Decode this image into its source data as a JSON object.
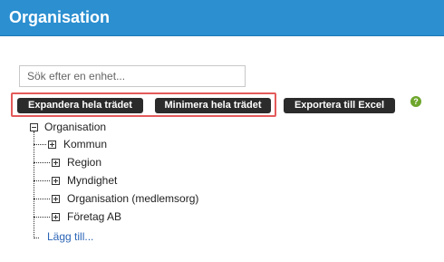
{
  "header": {
    "title": "Organisation"
  },
  "search": {
    "placeholder": "Sök efter en enhet..."
  },
  "toolbar": {
    "expand_label": "Expandera hela trädet",
    "collapse_label": "Minimera hela trädet",
    "export_label": "Exportera till Excel",
    "help_icon": "?"
  },
  "tree": {
    "root": "Organisation",
    "children": [
      "Kommun",
      "Region",
      "Myndighet",
      "Organisation (medlemsorg)",
      "Företag AB"
    ],
    "add_link": "Lägg till..."
  },
  "colors": {
    "header_bg": "#2b8fd0",
    "button_bg": "#2b2b2b",
    "highlight_border": "#e45a5a",
    "link": "#2a64b6",
    "help_icon": "#6ea62c"
  }
}
